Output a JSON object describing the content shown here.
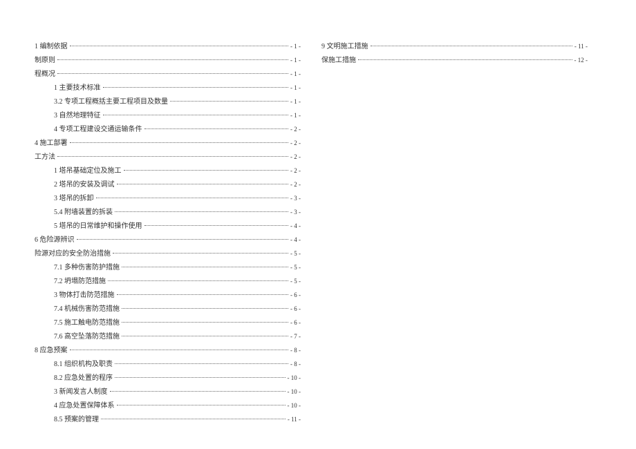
{
  "toc": {
    "left": [
      {
        "label": "1 编制依据",
        "page": "- 1 -",
        "indent": 0
      },
      {
        "label": "制原则",
        "page": "- 1 -",
        "indent": 0
      },
      {
        "label": "程概况",
        "page": "- 1 -",
        "indent": 0
      },
      {
        "label": "1 主要技术标准",
        "page": "- 1 -",
        "indent": 1
      },
      {
        "label": "3.2 专项工程概括主要工程项目及数量",
        "page": "- 1 -",
        "indent": 1
      },
      {
        "label": "3 自然地理特征",
        "page": "- 1 -",
        "indent": 1
      },
      {
        "label": "4 专项工程建设交通运输条件",
        "page": "- 2 -",
        "indent": 1
      },
      {
        "label": "4 施工部署",
        "page": "- 2 -",
        "indent": 0
      },
      {
        "label": "工方法",
        "page": "- 2 -",
        "indent": 0
      },
      {
        "label": "1 塔吊基础定位及施工",
        "page": "- 2 -",
        "indent": 1
      },
      {
        "label": "2 塔吊的安装及调试",
        "page": "- 2 -",
        "indent": 1
      },
      {
        "label": "3 塔吊的拆卸",
        "page": "- 3 -",
        "indent": 1
      },
      {
        "label": "5.4 附墙装置的拆装",
        "page": "- 3 -",
        "indent": 1
      },
      {
        "label": "5 塔吊的日常维护和操作使用",
        "page": "- 4 -",
        "indent": 1
      },
      {
        "label": "6 危险源辨识",
        "page": "- 4 -",
        "indent": 0
      },
      {
        "label": " 险源对应的安全防治措施",
        "page": "- 5 -",
        "indent": 0
      },
      {
        "label": "7.1 多种伤害防护措施",
        "page": "- 5 -",
        "indent": 1
      },
      {
        "label": "7.2 坍塌防范措施",
        "page": "- 5 -",
        "indent": 1
      },
      {
        "label": "3 物体打击防范措施",
        "page": "- 6 -",
        "indent": 1
      },
      {
        "label": "7.4 机械伤害防范措施",
        "page": "- 6 -",
        "indent": 1
      },
      {
        "label": "7.5 施工触电防范措施",
        "page": "- 6 -",
        "indent": 1
      },
      {
        "label": "7.6 高空坠落防范措施",
        "page": "- 7 -",
        "indent": 1
      },
      {
        "label": "8 应急预案",
        "page": "- 8 -",
        "indent": 0
      },
      {
        "label": "8.1 组织机构及职责",
        "page": "- 8 -",
        "indent": 1
      },
      {
        "label": "8.2 应急处置的程序",
        "page": "- 10 -",
        "indent": 1
      },
      {
        "label": "3 新闻发言人制度",
        "page": "- 10 -",
        "indent": 1
      },
      {
        "label": "4 应急处置保障体系",
        "page": "- 10 -",
        "indent": 1
      },
      {
        "label": "8.5 预案的管理",
        "page": "- 11 -",
        "indent": 1
      }
    ],
    "right": [
      {
        "label": "9 文明施工措施",
        "page": "- 11 -",
        "indent": 0
      },
      {
        "label": " 保施工措施",
        "page": "- 12 -",
        "indent": 0
      }
    ]
  }
}
